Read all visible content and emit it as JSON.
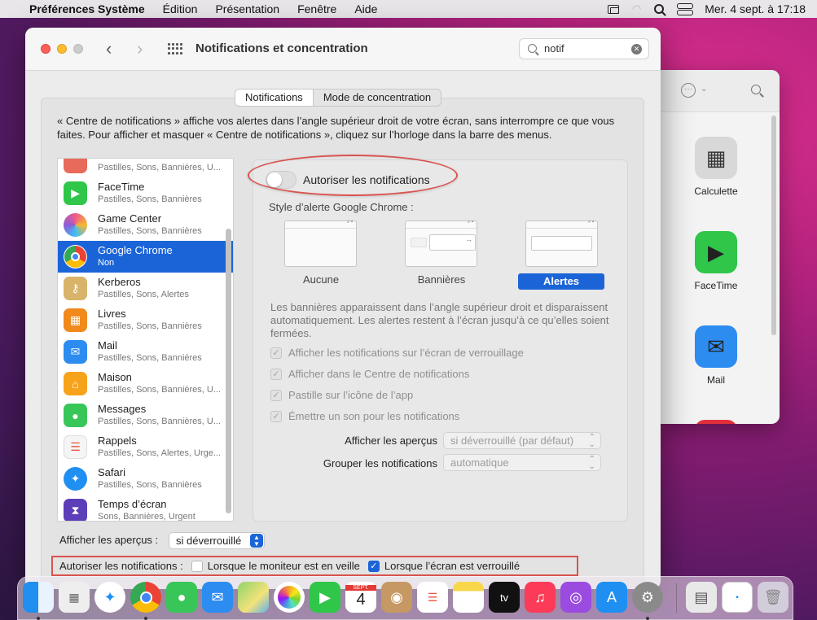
{
  "menubar": {
    "app_name": "Préférences Système",
    "items": [
      "Édition",
      "Présentation",
      "Fenêtre",
      "Aide"
    ],
    "datetime": "Mer. 4 sept. à 17:18",
    "icons": [
      "apple-icon",
      "screen-mirroring-icon",
      "wifi-icon",
      "spotlight-search-icon",
      "control-center-icon"
    ]
  },
  "window": {
    "title": "Notifications et concentration",
    "search_value": "notif",
    "tabs": [
      {
        "label": "Notifications",
        "active": true
      },
      {
        "label": "Mode de concentration",
        "active": false
      }
    ],
    "description": "« Centre de notifications » affiche vos alertes dans l’angle supérieur droit de votre écran, sans interrompre ce que vous faites. Pour afficher et masquer « Centre de notifications », cliquez sur l’horloge dans la barre des menus."
  },
  "apps": [
    {
      "name": "",
      "sub": "Pastilles, Sons, Bannières, U...",
      "color": "#e86a5a",
      "glyph": ""
    },
    {
      "name": "FaceTime",
      "sub": "Pastilles, Sons, Bannières",
      "color": "#2fc64a",
      "glyph": "▶"
    },
    {
      "name": "Game Center",
      "sub": "Pastilles, Sons, Bannières",
      "color": "#8e5bd6",
      "glyph": "●"
    },
    {
      "name": "Google Chrome",
      "sub": "Non",
      "color": "#ffffff",
      "glyph": "◉",
      "selected": true
    },
    {
      "name": "Kerberos",
      "sub": "Pastilles, Sons, Alertes",
      "color": "#d8b36a",
      "glyph": "⚷"
    },
    {
      "name": "Livres",
      "sub": "Pastilles, Sons, Bannières",
      "color": "#f08a1c",
      "glyph": "▦"
    },
    {
      "name": "Mail",
      "sub": "Pastilles, Sons, Bannières",
      "color": "#2c8cf0",
      "glyph": "✉"
    },
    {
      "name": "Maison",
      "sub": "Pastilles, Sons, Bannières, U...",
      "color": "#f7a21b",
      "glyph": "⌂"
    },
    {
      "name": "Messages",
      "sub": "Pastilles, Sons, Bannières, U...",
      "color": "#38c659",
      "glyph": "●"
    },
    {
      "name": "Rappels",
      "sub": "Pastilles, Sons, Alertes, Urge...",
      "color": "#f5f5f5",
      "glyph": "☰"
    },
    {
      "name": "Safari",
      "sub": "Pastilles, Sons, Bannières",
      "color": "#1f8ff2",
      "glyph": "✦"
    },
    {
      "name": "Temps d’écran",
      "sub": "Sons, Bannières, Urgent",
      "color": "#5c3fb8",
      "glyph": "⧗"
    }
  ],
  "detail": {
    "allow_label": "Autoriser les notifications",
    "allow_on": false,
    "style_label": "Style d’alerte Google Chrome :",
    "styles": [
      "Aucune",
      "Bannières",
      "Alertes"
    ],
    "active_style": "Alertes",
    "explanation": "Les bannières apparaissent dans l’angle supérieur droit et disparaissent automatiquement. Les alertes restent à l’écran jusqu’à ce qu’elles soient fermées.",
    "checkboxes": [
      "Afficher les notifications sur l’écran de verrouillage",
      "Afficher dans le Centre de notifications",
      "Pastille sur l’icône de l’app",
      "Émettre un son pour les notifications"
    ],
    "previews_label": "Afficher les aperçus",
    "previews_value": "si déverrouillé (par défaut)",
    "group_label": "Grouper les notifications",
    "group_value": "automatique"
  },
  "bottom": {
    "previews_label": "Afficher les aperçus :",
    "previews_value": "si déverrouillé",
    "allow_label": "Autoriser les notifications :",
    "opt1": "Lorsque le moniteur est en veille",
    "opt1_checked": false,
    "opt2": "Lorsque l’écran est verrouillé",
    "opt2_checked": true
  },
  "background_window": {
    "apps": [
      "Calculette",
      "FaceTime",
      "Mail"
    ]
  },
  "dock": {
    "calendar_month": "SEPT.",
    "calendar_day": "4",
    "tv_label": "tv",
    "apps": [
      "finder-icon",
      "launchpad-icon",
      "safari-icon",
      "chrome-icon",
      "messages-icon",
      "mail-icon",
      "maps-icon",
      "photos-icon",
      "facetime-icon",
      "calendar-icon",
      "contacts-icon",
      "reminders-icon",
      "notes-icon",
      "tv-icon",
      "music-icon",
      "podcasts-icon",
      "app-store-icon",
      "system-preferences-icon",
      "preview-icon",
      "document-icon",
      "trash-icon"
    ]
  }
}
